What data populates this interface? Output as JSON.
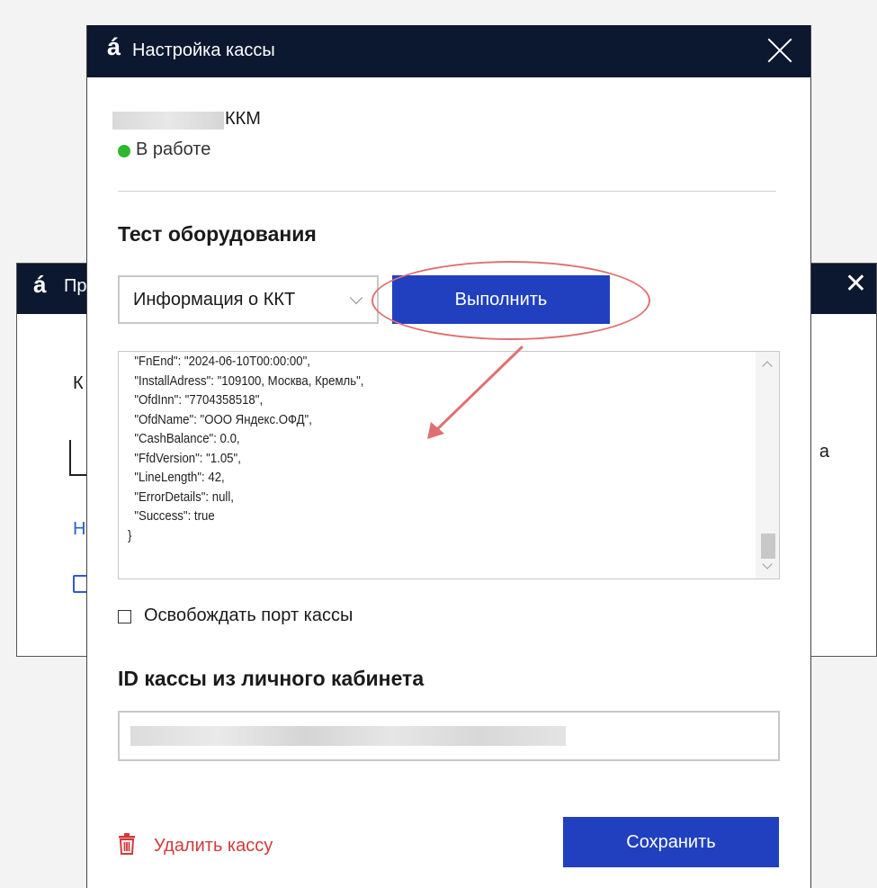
{
  "background_window": {
    "logo": "á",
    "title_fragment": "Пр",
    "fragment_k": "К",
    "fragment_h": "Н",
    "fragment_a": "а"
  },
  "dialog": {
    "logo": "á",
    "title": "Настройка кассы",
    "device": {
      "name": "ККМ",
      "status": "В работе",
      "status_color": "#2eb82e"
    },
    "test_section": {
      "heading": "Тест оборудования",
      "selected_command": "Информация о ККТ",
      "run_button": "Выполнить"
    },
    "output_lines": [
      "  \"FnEnd\": \"2024-06-10T00:00:00\",",
      "  \"InstallAdress\": \"109100, Москва, Кремль\",",
      "  \"OfdInn\": \"7704358518\",",
      "  \"OfdName\": \"ООО Яндекс.ОФД\",",
      "  \"CashBalance\": 0.0,",
      "  \"FfdVersion\": \"1.05\",",
      "  \"LineLength\": 42,",
      "  \"ErrorDetails\": null,",
      "  \"Success\": true",
      "}"
    ],
    "release_port_label": "Освобождать порт кассы",
    "id_section": {
      "heading": "ID кассы из личного кабинета"
    },
    "delete_label": "Удалить кассу",
    "save_button": "Сохранить"
  },
  "colors": {
    "titlebar": "#0c1730",
    "primary_button": "#2040c0",
    "danger": "#d23a3a",
    "annotation": "#e07070"
  }
}
